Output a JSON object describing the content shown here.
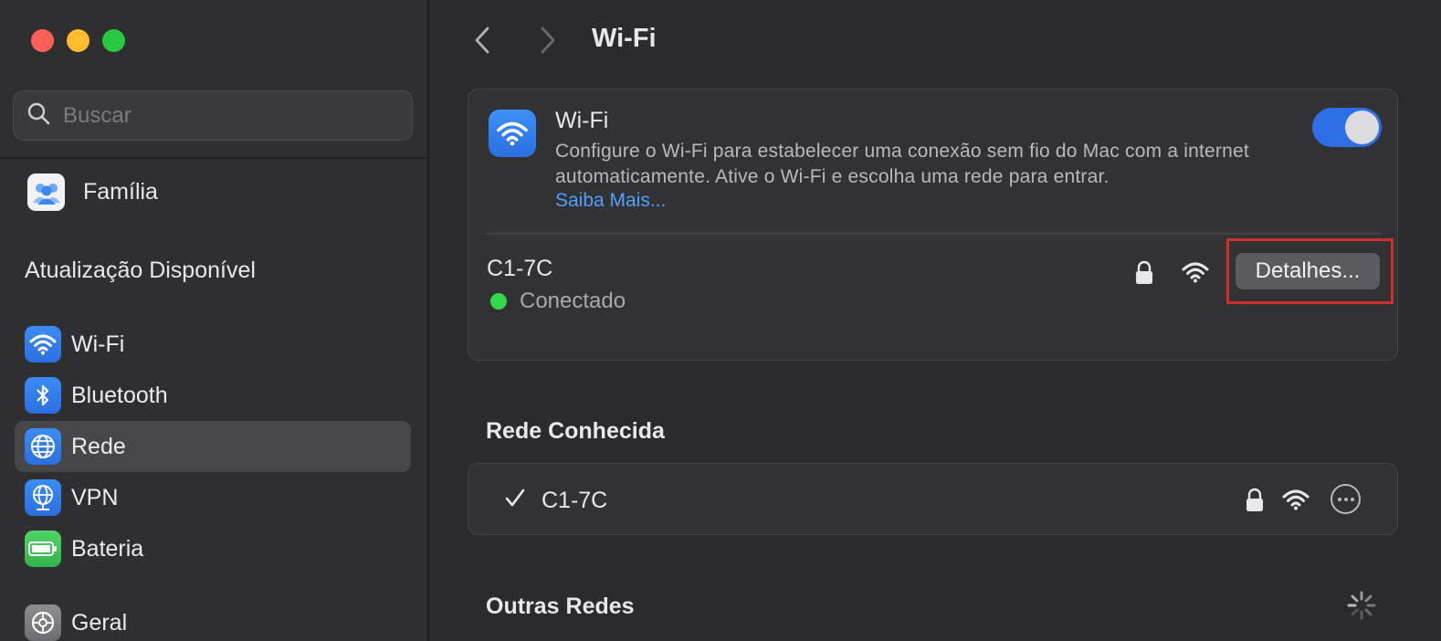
{
  "sidebar": {
    "search_placeholder": "Buscar",
    "family_label": "Família",
    "update_label": "Atualização Disponível",
    "items": [
      {
        "label": "Wi-Fi",
        "icon": "wifi-icon"
      },
      {
        "label": "Bluetooth",
        "icon": "bluetooth-icon"
      },
      {
        "label": "Rede",
        "icon": "globe-icon",
        "selected": true
      },
      {
        "label": "VPN",
        "icon": "vpn-globe-icon"
      },
      {
        "label": "Bateria",
        "icon": "battery-icon"
      },
      {
        "label": "Geral",
        "icon": "gear-icon"
      }
    ]
  },
  "main": {
    "title": "Wi-Fi",
    "wifi_card": {
      "title": "Wi-Fi",
      "description": "Configure o Wi-Fi para estabelecer uma conexão sem fio do Mac com a internet automaticamente. Ative o Wi-Fi e escolha uma rede para entrar.",
      "learn_more": "Saiba Mais...",
      "toggle_on": true,
      "current_network": "C1-7C",
      "status": "Conectado",
      "details_button": "Detalhes..."
    },
    "known_section_title": "Rede Conhecida",
    "known_networks": [
      {
        "name": "C1-7C",
        "checked": true
      }
    ],
    "other_section_title": "Outras Redes"
  },
  "colors": {
    "accent": "#2f6fe6",
    "link": "#4fa0ff",
    "connected": "#32d74b",
    "highlight": "#d0302b"
  }
}
